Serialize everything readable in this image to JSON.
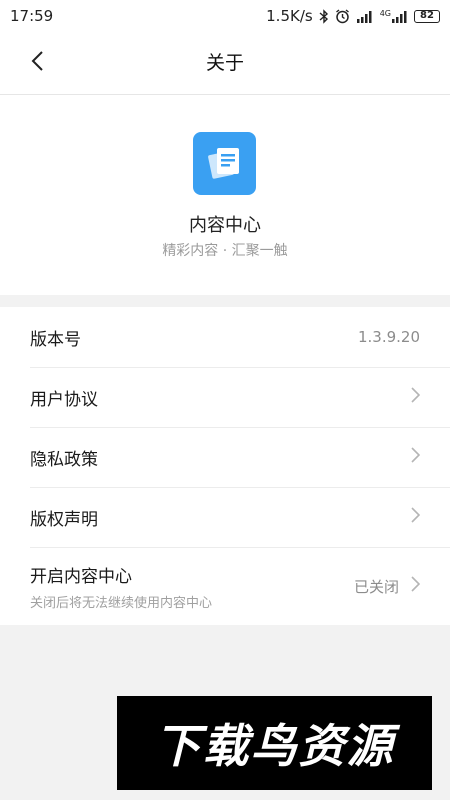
{
  "status_bar": {
    "time": "17:59",
    "network_speed": "1.5K/s",
    "network_type": "4G",
    "battery": "82",
    "icons": [
      "bluetooth-icon",
      "alarm-icon",
      "signal-icon",
      "signal-4g-icon",
      "battery-icon"
    ]
  },
  "header": {
    "title": "关于",
    "back_icon": "chevron-left-icon"
  },
  "app": {
    "name": "内容中心",
    "slogan": "精彩内容 · 汇聚一触",
    "icon": "document-stack-icon",
    "icon_color": "#3aa0f2"
  },
  "settings": {
    "version": {
      "label": "版本号",
      "value": "1.3.9.20"
    },
    "user_agreement": {
      "label": "用户协议"
    },
    "privacy_policy": {
      "label": "隐私政策"
    },
    "copyright": {
      "label": "版权声明"
    },
    "enable_center": {
      "label": "开启内容中心",
      "subtitle": "关闭后将无法继续使用内容中心",
      "value": "已关闭"
    }
  },
  "watermark": {
    "text": "下载鸟资源"
  }
}
